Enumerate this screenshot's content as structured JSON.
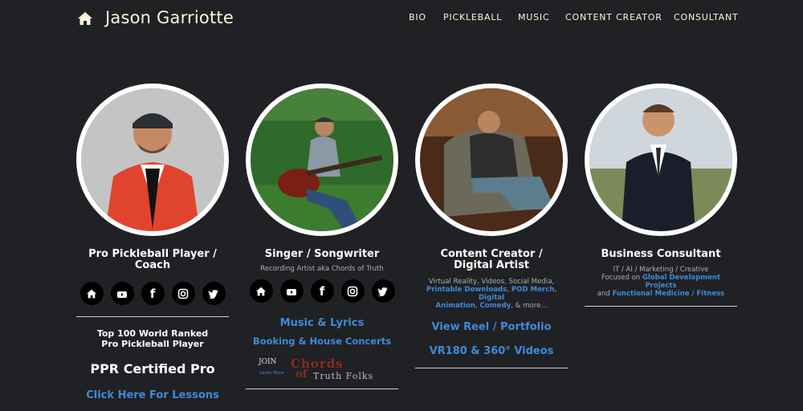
{
  "site": {
    "title": "Jason Garriotte"
  },
  "nav": [
    {
      "label": "BIO"
    },
    {
      "label": "PICKLEBALL"
    },
    {
      "label": "MUSIC"
    },
    {
      "label": "CONTENT CREATOR"
    },
    {
      "label": "CONSULTANT"
    }
  ],
  "cards": {
    "pickleball": {
      "title_line1": "Pro Pickleball Player /",
      "title_line2": "Coach",
      "rank_line1": "Top 100 World Ranked",
      "rank_line2": "Pro Pickleball Player",
      "certified": "PPR Certified Pro",
      "lessons_link": "Click Here For Lessons"
    },
    "music": {
      "title": "Singer / Songwriter",
      "subtitle": "Recording Artist aka Chords of Truth",
      "music_link": "Music & Lyrics",
      "booking_link": "Booking & House Concerts",
      "logo_text": "JOIN Chords of Truth Folks",
      "logo_small": "Learn More"
    },
    "content": {
      "title_line1": "Content Creator /",
      "title_line2": "Digital Artist",
      "desc_1": "Virtual Reality, Videos, Social Media,",
      "desc_link_1": "Printable Downloads",
      "desc_sep_1": ", ",
      "desc_link_2": "POD Merch",
      "desc_sep_2": ", ",
      "desc_link_3": "Digital",
      "desc_link_4": "Animation",
      "desc_sep_3": ", ",
      "desc_link_5": "Comedy",
      "desc_tail": ", & more...",
      "reel_link": "View Reel / Portfolio",
      "vr_link": "VR180 & 360° Videos"
    },
    "consultant": {
      "title": "Business Consultant",
      "line1": "IT / AI / Marketing / Creative",
      "line2_prefix": "Focused on ",
      "line2_link": "Global Development Projects",
      "line3_prefix": "and ",
      "line3_link": "Functional Medicine / Fitness"
    }
  },
  "social": [
    "home-icon",
    "youtube-icon",
    "facebook-icon",
    "instagram-icon",
    "twitter-icon"
  ],
  "colors": {
    "background": "#202124",
    "link": "#3f8ad8",
    "nav_text": "#fff4dc"
  }
}
